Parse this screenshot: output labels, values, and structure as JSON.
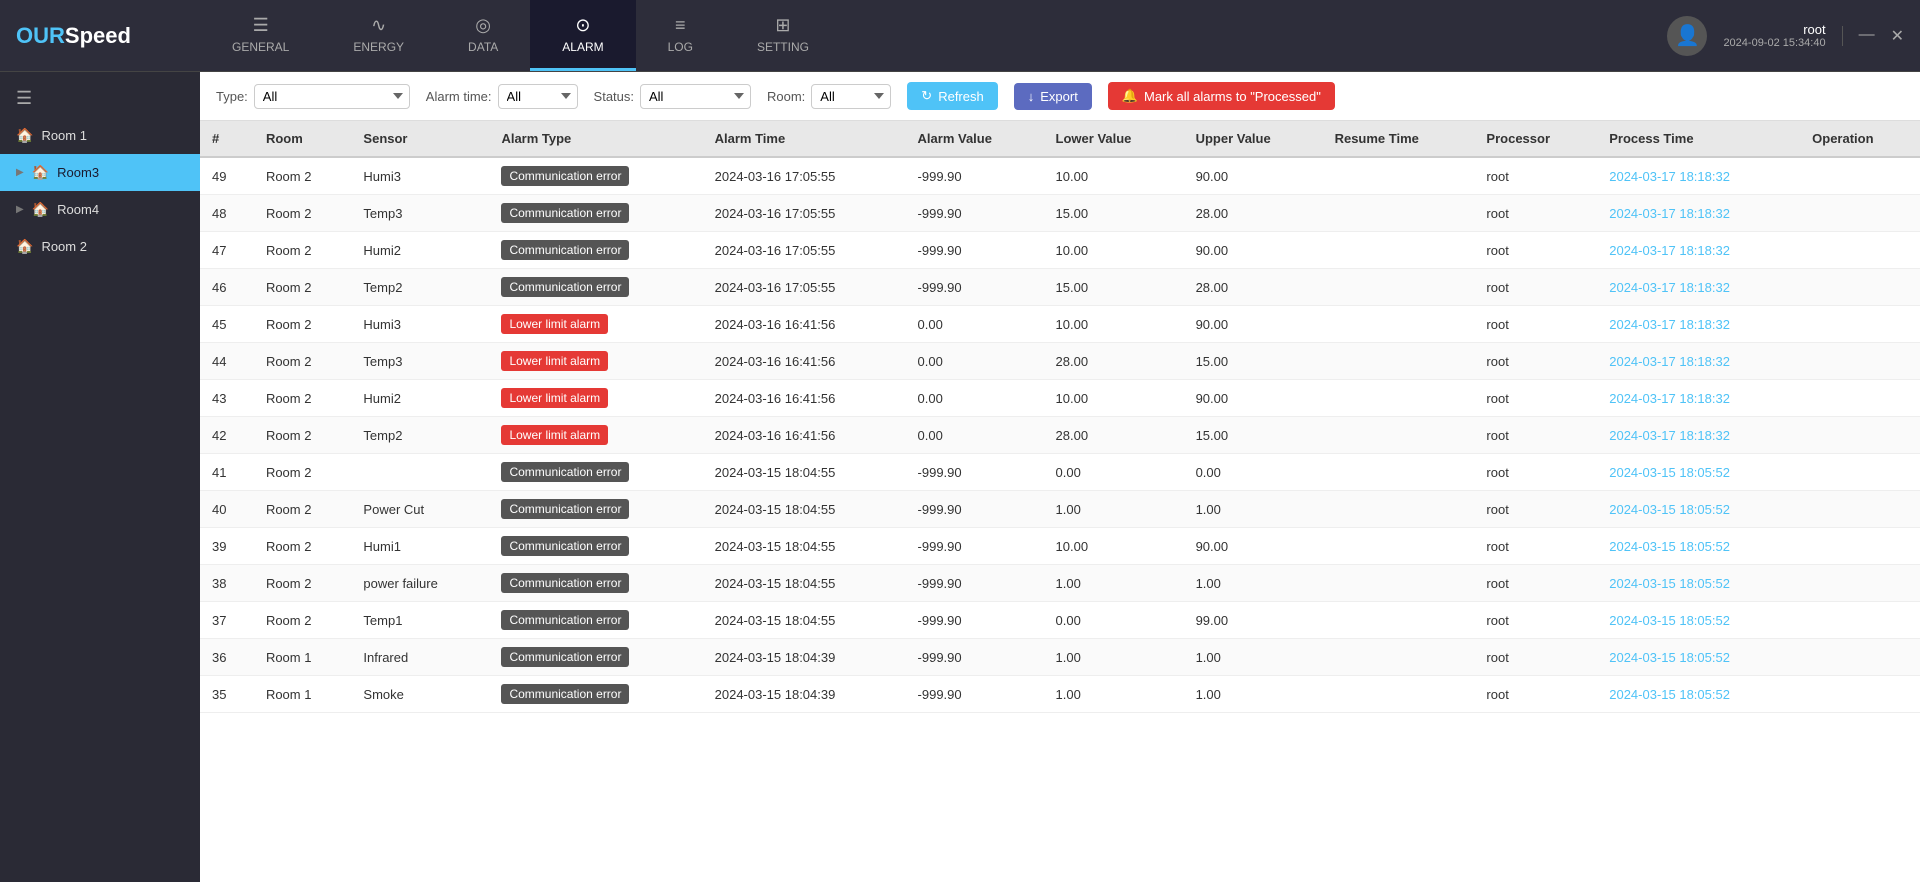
{
  "app": {
    "logo_our": "OUR",
    "logo_speed": "Speed"
  },
  "header": {
    "user_name": "root",
    "user_time": "2024-09-02 15:34:40",
    "window_minimize": "—",
    "window_close": "✕"
  },
  "nav": {
    "tabs": [
      {
        "id": "general",
        "label": "GENERAL",
        "icon": "☰"
      },
      {
        "id": "energy",
        "label": "ENERGY",
        "icon": "∿"
      },
      {
        "id": "data",
        "label": "DATA",
        "icon": "◎"
      },
      {
        "id": "alarm",
        "label": "ALARM",
        "icon": "⊙"
      },
      {
        "id": "log",
        "label": "LOG",
        "icon": "≡"
      },
      {
        "id": "setting",
        "label": "SETTING",
        "icon": "⊞"
      }
    ],
    "active": "alarm"
  },
  "sidebar": {
    "header_icon": "☰",
    "items": [
      {
        "id": "room1",
        "label": "Room 1",
        "expandable": false,
        "active": false
      },
      {
        "id": "room3",
        "label": "Room3",
        "expandable": true,
        "active": true
      },
      {
        "id": "room4",
        "label": "Room4",
        "expandable": true,
        "active": false
      },
      {
        "id": "room2",
        "label": "Room 2",
        "expandable": false,
        "active": false
      }
    ]
  },
  "toolbar": {
    "type_label": "Type:",
    "type_value": "All",
    "alarm_time_label": "Alarm time:",
    "alarm_time_value": "All",
    "status_label": "Status:",
    "status_value": "All",
    "room_label": "Room:",
    "room_value": "All",
    "refresh_label": "Refresh",
    "export_label": "Export",
    "mark_label": "Mark all alarms to \"Processed\""
  },
  "table": {
    "columns": [
      "#",
      "Room",
      "Sensor",
      "Alarm Type",
      "Alarm Time",
      "Alarm Value",
      "Lower Value",
      "Upper Value",
      "Resume Time",
      "Processor",
      "Process Time",
      "Operation"
    ],
    "rows": [
      {
        "num": 49,
        "room": "Room 2",
        "sensor": "Humi3",
        "alarm_type": "Communication error",
        "alarm_type_style": "comm",
        "alarm_time": "2024-03-16 17:05:55",
        "alarm_value": "-999.90",
        "lower_value": "10.00",
        "upper_value": "90.00",
        "resume_time": "",
        "processor": "root",
        "process_time": "2024-03-17 18:18:32",
        "operation": ""
      },
      {
        "num": 48,
        "room": "Room 2",
        "sensor": "Temp3",
        "alarm_type": "Communication error",
        "alarm_type_style": "comm",
        "alarm_time": "2024-03-16 17:05:55",
        "alarm_value": "-999.90",
        "lower_value": "15.00",
        "upper_value": "28.00",
        "resume_time": "",
        "processor": "root",
        "process_time": "2024-03-17 18:18:32",
        "operation": ""
      },
      {
        "num": 47,
        "room": "Room 2",
        "sensor": "Humi2",
        "alarm_type": "Communication error",
        "alarm_type_style": "comm",
        "alarm_time": "2024-03-16 17:05:55",
        "alarm_value": "-999.90",
        "lower_value": "10.00",
        "upper_value": "90.00",
        "resume_time": "",
        "processor": "root",
        "process_time": "2024-03-17 18:18:32",
        "operation": ""
      },
      {
        "num": 46,
        "room": "Room 2",
        "sensor": "Temp2",
        "alarm_type": "Communication error",
        "alarm_type_style": "comm",
        "alarm_time": "2024-03-16 17:05:55",
        "alarm_value": "-999.90",
        "lower_value": "15.00",
        "upper_value": "28.00",
        "resume_time": "",
        "processor": "root",
        "process_time": "2024-03-17 18:18:32",
        "operation": ""
      },
      {
        "num": 45,
        "room": "Room 2",
        "sensor": "Humi3",
        "alarm_type": "Lower limit alarm",
        "alarm_type_style": "lower",
        "alarm_time": "2024-03-16 16:41:56",
        "alarm_value": "0.00",
        "lower_value": "10.00",
        "upper_value": "90.00",
        "resume_time": "",
        "processor": "root",
        "process_time": "2024-03-17 18:18:32",
        "operation": ""
      },
      {
        "num": 44,
        "room": "Room 2",
        "sensor": "Temp3",
        "alarm_type": "Lower limit alarm",
        "alarm_type_style": "lower",
        "alarm_time": "2024-03-16 16:41:56",
        "alarm_value": "0.00",
        "lower_value": "28.00",
        "upper_value": "15.00",
        "resume_time": "",
        "processor": "root",
        "process_time": "2024-03-17 18:18:32",
        "operation": ""
      },
      {
        "num": 43,
        "room": "Room 2",
        "sensor": "Humi2",
        "alarm_type": "Lower limit alarm",
        "alarm_type_style": "lower",
        "alarm_time": "2024-03-16 16:41:56",
        "alarm_value": "0.00",
        "lower_value": "10.00",
        "upper_value": "90.00",
        "resume_time": "",
        "processor": "root",
        "process_time": "2024-03-17 18:18:32",
        "operation": ""
      },
      {
        "num": 42,
        "room": "Room 2",
        "sensor": "Temp2",
        "alarm_type": "Lower limit alarm",
        "alarm_type_style": "lower",
        "alarm_time": "2024-03-16 16:41:56",
        "alarm_value": "0.00",
        "lower_value": "28.00",
        "upper_value": "15.00",
        "resume_time": "",
        "processor": "root",
        "process_time": "2024-03-17 18:18:32",
        "operation": ""
      },
      {
        "num": 41,
        "room": "Room 2",
        "sensor": "",
        "alarm_type": "Communication error",
        "alarm_type_style": "comm",
        "alarm_time": "2024-03-15 18:04:55",
        "alarm_value": "-999.90",
        "lower_value": "0.00",
        "upper_value": "0.00",
        "resume_time": "",
        "processor": "root",
        "process_time": "2024-03-15 18:05:52",
        "operation": ""
      },
      {
        "num": 40,
        "room": "Room 2",
        "sensor": "Power Cut",
        "alarm_type": "Communication error",
        "alarm_type_style": "comm",
        "alarm_time": "2024-03-15 18:04:55",
        "alarm_value": "-999.90",
        "lower_value": "1.00",
        "upper_value": "1.00",
        "resume_time": "",
        "processor": "root",
        "process_time": "2024-03-15 18:05:52",
        "operation": ""
      },
      {
        "num": 39,
        "room": "Room 2",
        "sensor": "Humi1",
        "alarm_type": "Communication error",
        "alarm_type_style": "comm",
        "alarm_time": "2024-03-15 18:04:55",
        "alarm_value": "-999.90",
        "lower_value": "10.00",
        "upper_value": "90.00",
        "resume_time": "",
        "processor": "root",
        "process_time": "2024-03-15 18:05:52",
        "operation": ""
      },
      {
        "num": 38,
        "room": "Room 2",
        "sensor": "power failure",
        "alarm_type": "Communication error",
        "alarm_type_style": "comm",
        "alarm_time": "2024-03-15 18:04:55",
        "alarm_value": "-999.90",
        "lower_value": "1.00",
        "upper_value": "1.00",
        "resume_time": "",
        "processor": "root",
        "process_time": "2024-03-15 18:05:52",
        "operation": ""
      },
      {
        "num": 37,
        "room": "Room 2",
        "sensor": "Temp1",
        "alarm_type": "Communication error",
        "alarm_type_style": "comm",
        "alarm_time": "2024-03-15 18:04:55",
        "alarm_value": "-999.90",
        "lower_value": "0.00",
        "upper_value": "99.00",
        "resume_time": "",
        "processor": "root",
        "process_time": "2024-03-15 18:05:52",
        "operation": ""
      },
      {
        "num": 36,
        "room": "Room 1",
        "sensor": "Infrared",
        "alarm_type": "Communication error",
        "alarm_type_style": "comm",
        "alarm_time": "2024-03-15 18:04:39",
        "alarm_value": "-999.90",
        "lower_value": "1.00",
        "upper_value": "1.00",
        "resume_time": "",
        "processor": "root",
        "process_time": "2024-03-15 18:05:52",
        "operation": ""
      },
      {
        "num": 35,
        "room": "Room 1",
        "sensor": "Smoke",
        "alarm_type": "Communication error",
        "alarm_type_style": "comm",
        "alarm_time": "2024-03-15 18:04:39",
        "alarm_value": "-999.90",
        "lower_value": "1.00",
        "upper_value": "1.00",
        "resume_time": "",
        "processor": "root",
        "process_time": "2024-03-15 18:05:52",
        "operation": ""
      }
    ]
  }
}
